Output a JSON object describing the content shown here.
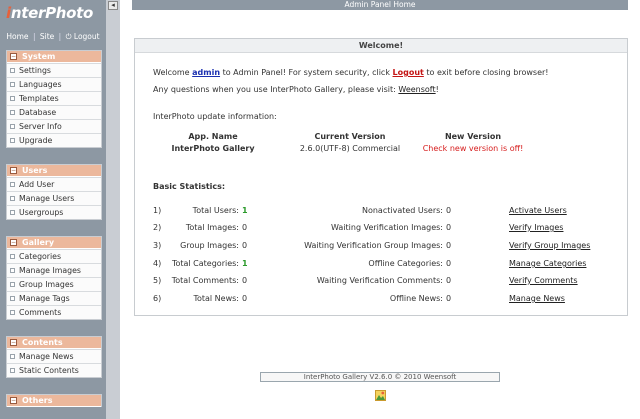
{
  "logo": {
    "first": "i",
    "rest": "nterPhoto"
  },
  "top_links": {
    "home": "Home",
    "site": "Site",
    "logout": "Logout",
    "sep": "|",
    "power_glyph": "⏻"
  },
  "sidebar": {
    "groups": [
      {
        "title": "System",
        "items": [
          "Settings",
          "Languages",
          "Templates",
          "Database",
          "Server Info",
          "Upgrade"
        ]
      },
      {
        "title": "Users",
        "items": [
          "Add User",
          "Manage Users",
          "Usergroups"
        ]
      },
      {
        "title": "Gallery",
        "items": [
          "Categories",
          "Manage Images",
          "Group Images",
          "Manage Tags",
          "Comments"
        ]
      },
      {
        "title": "Contents",
        "items": [
          "Manage News",
          "Static Contents"
        ]
      },
      {
        "title": "Others",
        "items": []
      }
    ],
    "toggle_glyph": "−"
  },
  "header": {
    "title": "Admin Panel Home"
  },
  "welcome": {
    "title": "Welcome!",
    "line1": {
      "pre": "Welcome ",
      "user": "admin",
      "mid": " to Admin Panel! For system security, click ",
      "logout": "Logout",
      "post": " to exit before closing browser!"
    },
    "line2": {
      "pre": "Any questions when you use InterPhoto Gallery, please visit: ",
      "link": "Weensoft",
      "post": "!"
    },
    "update_title": "InterPhoto update information:",
    "update_table": {
      "headers": [
        "App. Name",
        "Current Version",
        "New Version"
      ],
      "row": [
        "InterPhoto Gallery",
        "2.6.0(UTF-8) Commercial",
        "Check new version is off!"
      ]
    },
    "stats_title": "Basic Statistics:",
    "stats": [
      {
        "num": "1)",
        "label": "Total Users:",
        "value": "1",
        "label2": "Nonactivated Users:",
        "value2": "0",
        "action": "Activate Users"
      },
      {
        "num": "2)",
        "label": "Total Images:",
        "value": "0",
        "label2": "Waiting Verification Images:",
        "value2": "0",
        "action": "Verify Images"
      },
      {
        "num": "3)",
        "label": "Group Images:",
        "value": "0",
        "label2": "Waiting Verification Group Images:",
        "value2": "0",
        "action": "Verify Group Images"
      },
      {
        "num": "4)",
        "label": "Total Categories:",
        "value": "1",
        "label2": "Offline Categories:",
        "value2": "0",
        "action": "Manage Categories"
      },
      {
        "num": "5)",
        "label": "Total Comments:",
        "value": "0",
        "label2": "Waiting Verification Comments:",
        "value2": "0",
        "action": "Verify Comments"
      },
      {
        "num": "6)",
        "label": "Total News:",
        "value": "0",
        "label2": "Offline News:",
        "value2": "0",
        "action": "Manage News"
      }
    ]
  },
  "footer": {
    "text": "InterPhoto Gallery V2.6.0 © 2010 Weensoft"
  },
  "colors": {
    "sidebar": "#8d98a3",
    "group_header": "#ecb89c",
    "link_blue": "#1a2fb0",
    "link_red": "#c41414",
    "value_green": "#2b9a2b"
  }
}
